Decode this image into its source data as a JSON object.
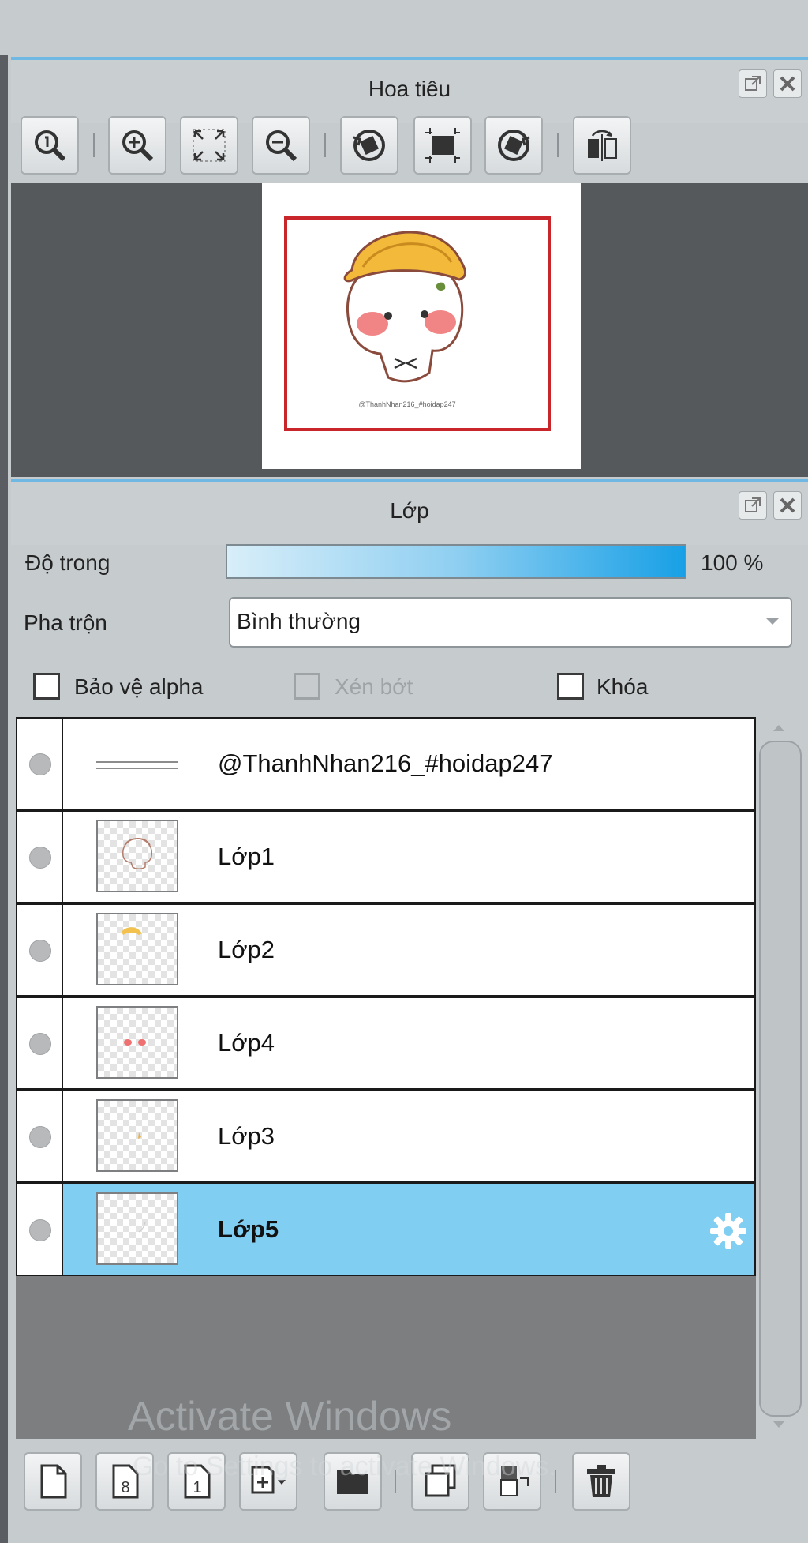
{
  "navigator": {
    "title": "Hoa tiêu",
    "toolbar": [
      {
        "icon": "zoom-actual-size-icon"
      },
      {
        "icon": "zoom-in-icon"
      },
      {
        "icon": "fit-to-window-icon"
      },
      {
        "icon": "zoom-out-icon"
      },
      {
        "icon": "rotate-left-icon"
      },
      {
        "icon": "reset-view-icon"
      },
      {
        "icon": "rotate-right-icon"
      },
      {
        "icon": "flip-horizontal-icon"
      }
    ],
    "preview_caption": "@ThanhNhan216_#hoidap247"
  },
  "layers_panel": {
    "title": "Lớp",
    "opacity_label": "Độ trong",
    "opacity_value": "100 %",
    "opacity_level": 1.0,
    "blend_label": "Pha trộn",
    "blend_value": "Bình thường",
    "protect_alpha_label": "Bảo vệ alpha",
    "clipping_label": "Xén bớt",
    "lock_label": "Khóa",
    "layers": [
      {
        "name": "@ThanhNhan216_#hoidap247",
        "type": "text",
        "selected": false
      },
      {
        "name": "Lớp1",
        "type": "image",
        "selected": false
      },
      {
        "name": "Lớp2",
        "type": "image",
        "selected": false
      },
      {
        "name": "Lớp4",
        "type": "image",
        "selected": false
      },
      {
        "name": "Lớp3",
        "type": "image",
        "selected": false
      },
      {
        "name": "Lớp5",
        "type": "image",
        "selected": true
      }
    ],
    "bottom_toolbar": [
      {
        "icon": "new-color-layer-icon"
      },
      {
        "icon": "new-8bit-layer-icon"
      },
      {
        "icon": "new-1bit-layer-icon"
      },
      {
        "icon": "add-layer-menu-icon"
      },
      {
        "icon": "new-folder-icon"
      },
      {
        "icon": "duplicate-layer-icon"
      },
      {
        "icon": "merge-down-icon"
      },
      {
        "icon": "delete-layer-icon"
      }
    ]
  },
  "watermark": {
    "line1": "Activate Windows",
    "line2": "Go to Settings to activate Windows."
  },
  "colors": {
    "accent": "#6fb8e3",
    "selected_row": "#80cef2",
    "frame_red": "#c8262a"
  }
}
